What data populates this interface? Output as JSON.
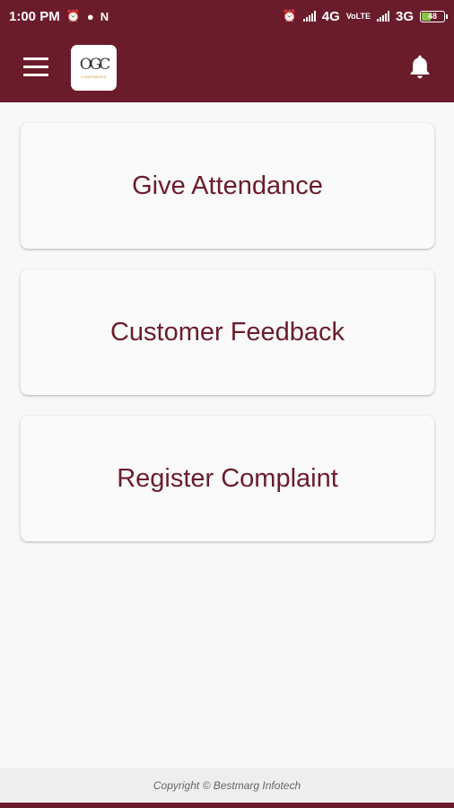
{
  "status_bar": {
    "time": "1:00 PM",
    "network_left": "4G",
    "volte_label": "VoLTE",
    "network_right": "3G",
    "battery_level": "48",
    "icons": [
      "alarm-icon",
      "jio-icon",
      "n-notification-icon",
      "alarm-icon",
      "signal-icon",
      "signal-icon",
      "battery-icon"
    ]
  },
  "toolbar": {
    "logo_text": "OGC",
    "logo_subtext": "COMPANIES"
  },
  "menu": [
    {
      "label": "Give Attendance"
    },
    {
      "label": "Customer Feedback"
    },
    {
      "label": "Register Complaint"
    }
  ],
  "footer": {
    "copyright": "Copyright ©  Bestmarg Infotech"
  },
  "colors": {
    "primary": "#6b1c2b",
    "background": "#f8f8f8",
    "card": "#fafafa",
    "battery": "#8bc34a"
  }
}
